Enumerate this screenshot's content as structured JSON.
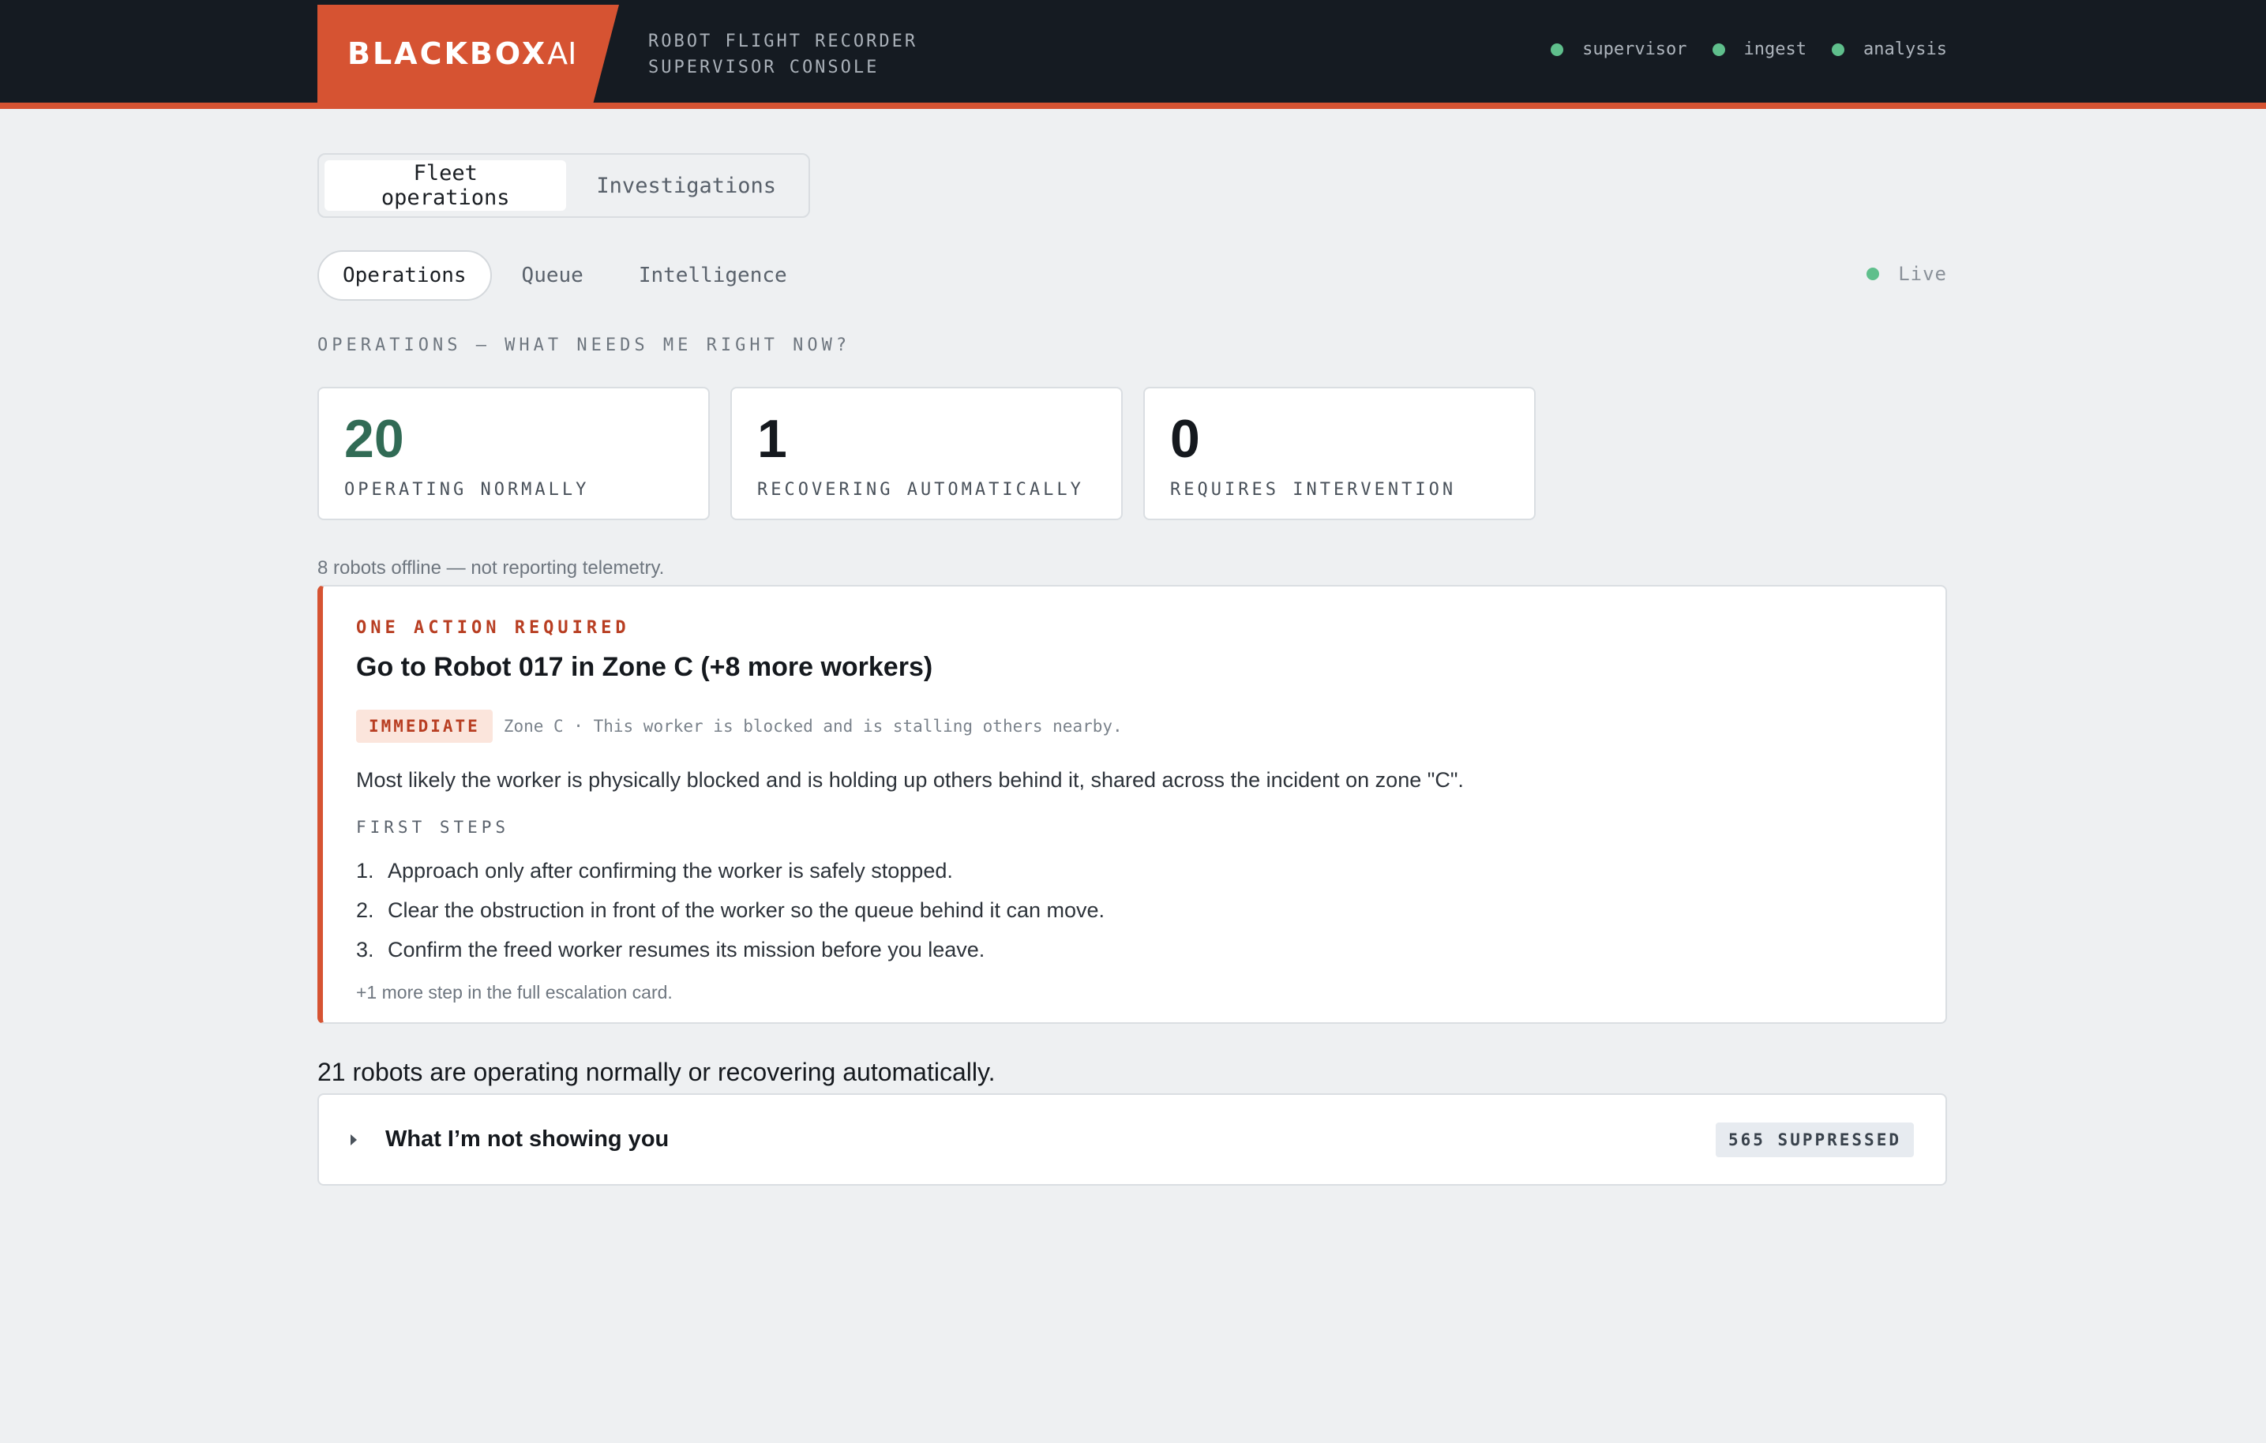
{
  "header": {
    "brand_main": "BLACKBOX",
    "brand_suffix": "AI",
    "console_line1": "ROBOT FLIGHT RECORDER",
    "console_line2": "SUPERVISOR CONSOLE",
    "services": [
      "supervisor",
      "ingest",
      "analysis"
    ],
    "accent_color": "#d65332",
    "status_color": "#5fbf8c"
  },
  "mode_tabs": {
    "items": [
      {
        "label": "Fleet operations",
        "active": true
      },
      {
        "label": "Investigations",
        "active": false
      }
    ]
  },
  "subnav": {
    "items": [
      {
        "label": "Operations",
        "active": true
      },
      {
        "label": "Queue",
        "active": false
      },
      {
        "label": "Intelligence",
        "active": false
      }
    ],
    "live_label": "Live"
  },
  "operations": {
    "section_label": "OPERATIONS — WHAT NEEDS ME RIGHT NOW?",
    "stats": [
      {
        "value": "20",
        "label": "OPERATING NORMALLY"
      },
      {
        "value": "1",
        "label": "RECOVERING AUTOMATICALLY"
      },
      {
        "value": "0",
        "label": "REQUIRES INTERVENTION"
      }
    ],
    "offline_note": "8 robots offline — not reporting telemetry."
  },
  "action": {
    "kicker": "ONE ACTION REQUIRED",
    "title": "Go to Robot 017 in Zone C (+8 more workers)",
    "badge": "IMMEDIATE",
    "meta": "Zone C · This worker is blocked and is stalling others nearby.",
    "description": "Most likely the worker is physically blocked and is holding up others behind it, shared across the incident on zone \"C\".",
    "steps_label": "FIRST STEPS",
    "steps": [
      {
        "num": "1.",
        "text": "Approach only after confirming the worker is safely stopped."
      },
      {
        "num": "2.",
        "text": "Clear the obstruction in front of the worker so the queue behind it can move."
      },
      {
        "num": "3.",
        "text": "Confirm the freed worker resumes its mission before you leave."
      }
    ],
    "more_steps": "+1 more step in the full escalation card."
  },
  "summary": "21 robots are operating normally or recovering automatically.",
  "suppressed": {
    "title": "What I’m not showing you",
    "badge": "565 SUPPRESSED"
  }
}
